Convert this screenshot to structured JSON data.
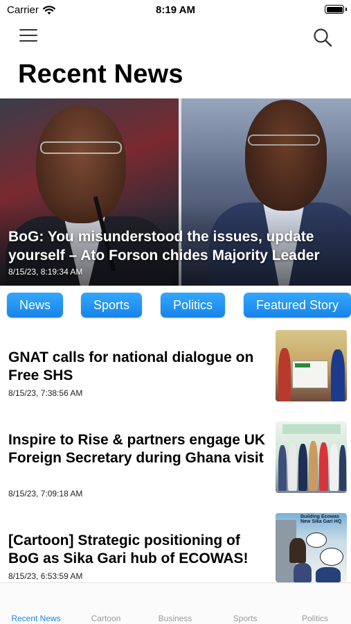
{
  "status_bar": {
    "carrier": "Carrier",
    "time": "8:19 AM"
  },
  "header": {
    "menu_icon": "hamburger-menu-icon",
    "search_icon": "search-icon",
    "title": "Recent News"
  },
  "hero": {
    "title": "BoG: You misunderstood the issues, update yourself – Ato Forson chides Majority Leader",
    "timestamp": "8/15/23, 8:19:34 AM"
  },
  "categories": [
    "News",
    "Sports",
    "Politics",
    "Featured Story"
  ],
  "articles": [
    {
      "title": "GNAT calls for national dialogue on Free SHS",
      "timestamp": "8/15/23, 7:38:56 AM"
    },
    {
      "title": "Inspire to Rise & partners engage UK Foreign Secretary during Ghana visit",
      "timestamp": "8/15/23, 7:09:18 AM"
    },
    {
      "title": "[Cartoon] Strategic positioning of BoG as Sika Gari hub of ECOWAS!",
      "timestamp": "8/15/23, 6:53:59 AM"
    }
  ],
  "thumb_labels": {
    "cartoon_caption": "Building Ecowas New Sika Gari HQ"
  },
  "tabs": [
    {
      "label": "Recent News",
      "active": true
    },
    {
      "label": "Cartoon",
      "active": false
    },
    {
      "label": "Business",
      "active": false
    },
    {
      "label": "Sports",
      "active": false
    },
    {
      "label": "Politics",
      "active": false
    }
  ],
  "colors": {
    "accent": "#1d86e8",
    "chip_top": "#33a8ff",
    "chip_bottom": "#1783e6",
    "inactive_tab": "#9a9a9a"
  }
}
